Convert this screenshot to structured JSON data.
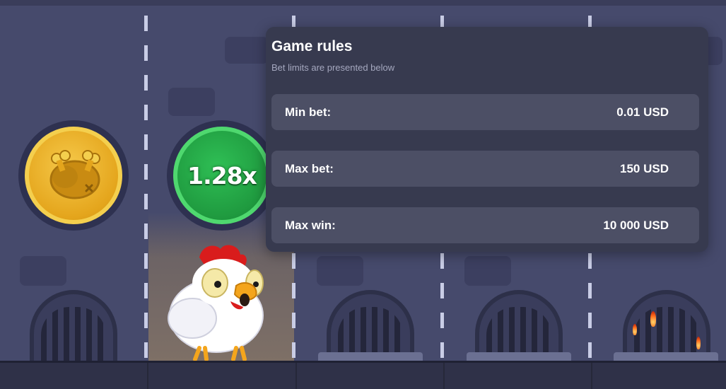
{
  "game": {
    "multiplier": "1.28x",
    "coins": [
      {
        "state": "lost",
        "icon": "roast-chicken-icon",
        "color": "#e4a51c"
      },
      {
        "state": "current",
        "color": "#1f9a3f"
      }
    ]
  },
  "rules_panel": {
    "title": "Game rules",
    "subtitle": "Bet limits are presented below",
    "rows": [
      {
        "label": "Min bet:",
        "value": "0.01 USD"
      },
      {
        "label": "Max bet:",
        "value": "150 USD"
      },
      {
        "label": "Max win:",
        "value": "10 000 USD"
      }
    ]
  },
  "colors": {
    "background": "#45486a",
    "panel": "#373a4f",
    "row": "#4c4f65",
    "gold_coin": "#e4a51c",
    "green_coin": "#1f9a3f"
  }
}
